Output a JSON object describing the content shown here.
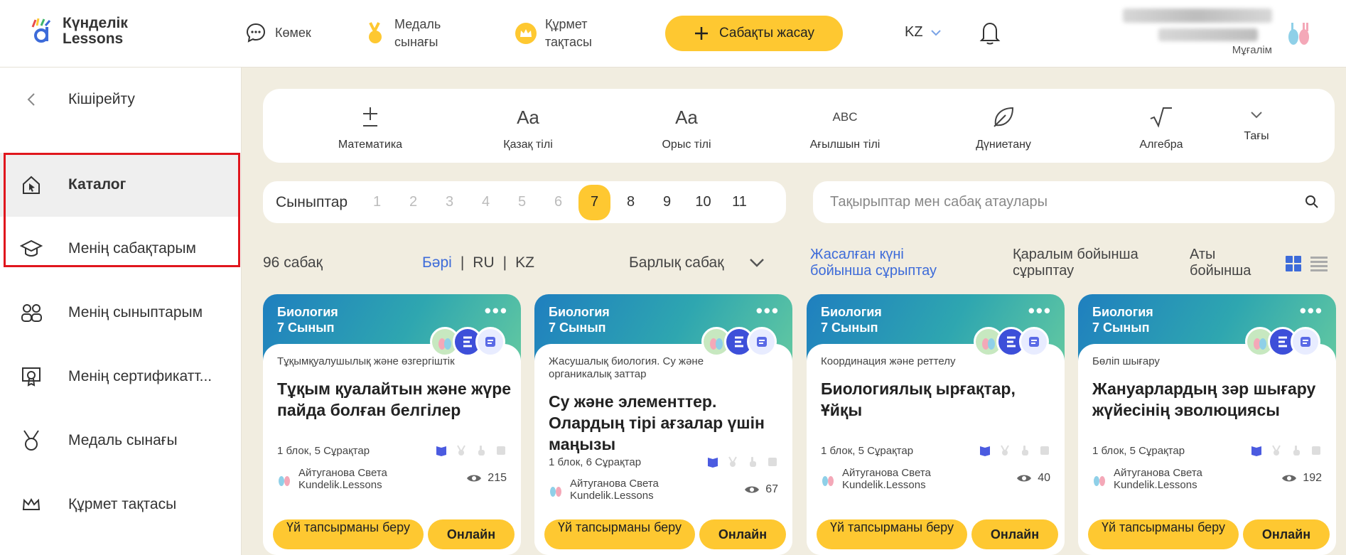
{
  "header": {
    "logo_line1": "Күнделік",
    "logo_line2": "Lessons",
    "help": "Көмек",
    "medal_line1": "Медаль",
    "medal_line2": "сынағы",
    "honor_line1": "Құрмет",
    "honor_line2": "тақтасы",
    "create_label": "Сабақты жасау",
    "lang": "KZ",
    "user_role": "Мұғалім"
  },
  "sidebar": {
    "collapse": "Кішірейту",
    "items": [
      {
        "label": "Каталог",
        "icon": "catalog-icon"
      },
      {
        "label": "Менің сабақтарым",
        "icon": "graduation-cap-icon"
      },
      {
        "label": "Менің сыныптарым",
        "icon": "people-icon"
      },
      {
        "label": "Менің сертификатт...",
        "icon": "certificate-icon"
      },
      {
        "label": "Медаль сынағы",
        "icon": "medal-icon"
      },
      {
        "label": "Құрмет тақтасы",
        "icon": "crown-icon"
      }
    ]
  },
  "subjects": [
    {
      "label": "Математика",
      "icon": "plus-minus-icon"
    },
    {
      "label": "Қазақ тілі",
      "icon": "Aa"
    },
    {
      "label": "Орыс тілі",
      "icon": "Aa"
    },
    {
      "label": "Ағылшын тілі",
      "icon": "ABC"
    },
    {
      "label": "Дүниетану",
      "icon": "leaf-icon"
    },
    {
      "label": "Алгебра",
      "icon": "sqrt-icon"
    }
  ],
  "more": "Тағы",
  "grades": {
    "label": "Сыныптар",
    "values": [
      "1",
      "2",
      "3",
      "4",
      "5",
      "6",
      "7",
      "8",
      "9",
      "10",
      "11"
    ],
    "selected": "7"
  },
  "search": {
    "placeholder": "Тақырыптар мен сабақ атаулары"
  },
  "filters": {
    "count": "96 сабақ",
    "lang_all": "Бәрі",
    "sep": "|",
    "lang_ru": "RU",
    "lang_kz": "KZ",
    "all_lessons": "Барлық сабақ",
    "sort_date_1": "Жасалған күні",
    "sort_date_2": "бойынша сұрыптау",
    "sort_views_1": "Қаралым бойынша",
    "sort_views_2": "сұрыптау",
    "sort_name_1": "Аты",
    "sort_name_2": "бойынша"
  },
  "cards": [
    {
      "subject": "Биология",
      "grade": "7 Сынып",
      "topic": "Тұқымқуалушылық және өзгергіштік",
      "title": "Тұқым қуалайтын және жүре пайда болған белгілер",
      "meta": "1 блок, 5 Сұрақтар",
      "author1": "Айтуганова Света",
      "author2": "Kundelik.Lessons",
      "views": "215",
      "btn1": "Үй тапсырманы беру",
      "btn2": "Онлайн"
    },
    {
      "subject": "Биология",
      "grade": "7 Сынып",
      "topic": "Жасушалық биология. Су және органикалық заттар",
      "title": "Су және элементтер. Олардың тірі ағзалар үшін маңызы",
      "meta": "1 блок, 6 Сұрақтар",
      "author1": "Айтуганова Света",
      "author2": "Kundelik.Lessons",
      "views": "67",
      "btn1": "Үй тапсырманы беру",
      "btn2": "Онлайн"
    },
    {
      "subject": "Биология",
      "grade": "7 Сынып",
      "topic": "Координация және реттелу",
      "title": "Биологиялық ырғақтар, Ұйқы",
      "meta": "1 блок, 5 Сұрақтар",
      "author1": "Айтуганова Света",
      "author2": "Kundelik.Lessons",
      "views": "40",
      "btn1": "Үй тапсырманы беру",
      "btn2": "Онлайн"
    },
    {
      "subject": "Биология",
      "grade": "7 Сынып",
      "topic": "Бөліп шығару",
      "title": "Жануарлардың зәр шығару жүйесінің эволюциясы",
      "meta": "1 блок, 5 Сұрақтар",
      "author1": "Айтуганова Света",
      "author2": "Kundelik.Lessons",
      "views": "192",
      "btn1": "Үй тапсырманы беру",
      "btn2": "Онлайн"
    }
  ],
  "colors": {
    "accent": "#fec831",
    "link": "#3d6bd9",
    "highlight": "#e0161d"
  }
}
